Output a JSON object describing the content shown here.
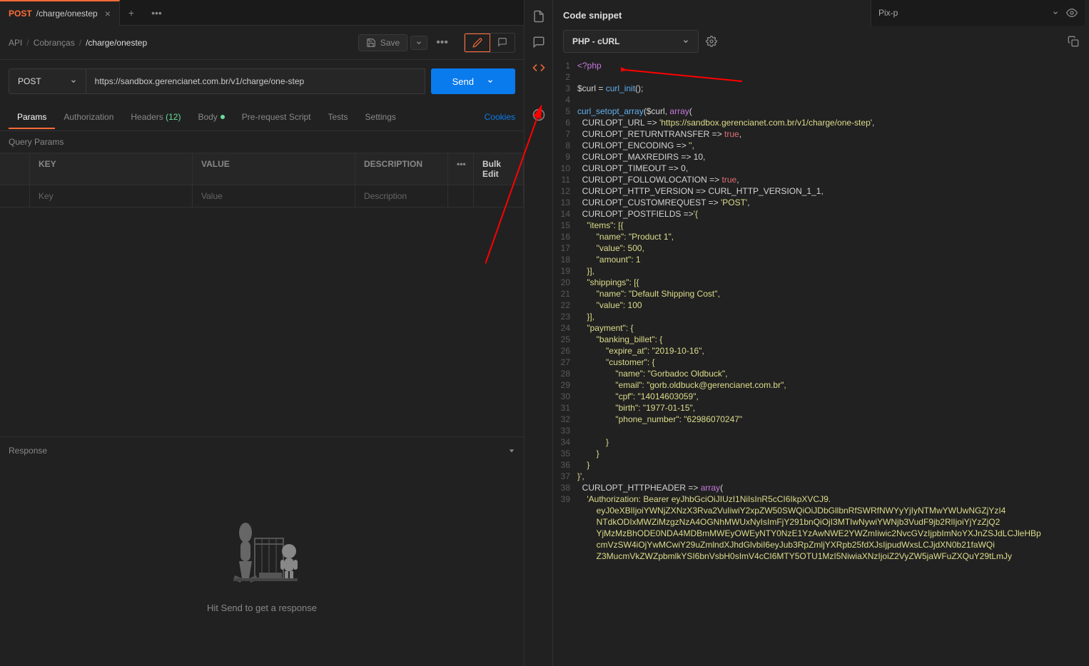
{
  "tabs": {
    "method": "POST",
    "title": "/charge/onestep"
  },
  "env": {
    "name": "Pix-p"
  },
  "breadcrumbs": {
    "a": "API",
    "b": "Cobranças",
    "c": "/charge/onestep"
  },
  "toolbar": {
    "save_label": "Save"
  },
  "request": {
    "method": "POST",
    "url": "https://sandbox.gerencianet.com.br/v1/charge/one-step",
    "send": "Send"
  },
  "reqtabs": {
    "params": "Params",
    "auth": "Authorization",
    "headers": "Headers",
    "headers_count": "(12)",
    "body": "Body",
    "prereq": "Pre-request Script",
    "tests": "Tests",
    "settings": "Settings",
    "cookies": "Cookies"
  },
  "qp": {
    "section": "Query Params",
    "key": "KEY",
    "value": "VALUE",
    "desc": "DESCRIPTION",
    "bulk": "Bulk Edit",
    "ph_key": "Key",
    "ph_value": "Value",
    "ph_desc": "Description"
  },
  "response": {
    "title": "Response",
    "empty": "Hit Send to get a response"
  },
  "snippet": {
    "title": "Code snippet",
    "language": "PHP - cURL",
    "lines": [
      {
        "n": 1,
        "tokens": [
          [
            "tag",
            "<?php"
          ]
        ]
      },
      {
        "n": 2,
        "tokens": [
          [
            "c",
            ""
          ]
        ]
      },
      {
        "n": 3,
        "tokens": [
          [
            "c",
            "$curl = "
          ],
          [
            "fn",
            "curl_init"
          ],
          [
            "c",
            "();"
          ]
        ]
      },
      {
        "n": 4,
        "tokens": [
          [
            "c",
            ""
          ]
        ]
      },
      {
        "n": 5,
        "tokens": [
          [
            "fn",
            "curl_setopt_array"
          ],
          [
            "c",
            "($curl, "
          ],
          [
            "kw",
            "array"
          ],
          [
            "c",
            "("
          ]
        ]
      },
      {
        "n": 6,
        "tokens": [
          [
            "c",
            "  CURLOPT_URL => "
          ],
          [
            "str",
            "'https://sandbox.gerencianet.com.br/v1/charge/one-step'"
          ],
          [
            "c",
            ","
          ]
        ]
      },
      {
        "n": 7,
        "tokens": [
          [
            "c",
            "  CURLOPT_RETURNTRANSFER => "
          ],
          [
            "lit",
            "true"
          ],
          [
            "c",
            ","
          ]
        ]
      },
      {
        "n": 8,
        "tokens": [
          [
            "c",
            "  CURLOPT_ENCODING => "
          ],
          [
            "str",
            "''"
          ],
          [
            "c",
            ","
          ]
        ]
      },
      {
        "n": 9,
        "tokens": [
          [
            "c",
            "  CURLOPT_MAXREDIRS => 10,"
          ]
        ]
      },
      {
        "n": 10,
        "tokens": [
          [
            "c",
            "  CURLOPT_TIMEOUT => 0,"
          ]
        ]
      },
      {
        "n": 11,
        "tokens": [
          [
            "c",
            "  CURLOPT_FOLLOWLOCATION => "
          ],
          [
            "lit",
            "true"
          ],
          [
            "c",
            ","
          ]
        ]
      },
      {
        "n": 12,
        "tokens": [
          [
            "c",
            "  CURLOPT_HTTP_VERSION => CURL_HTTP_VERSION_1_1,"
          ]
        ]
      },
      {
        "n": 13,
        "tokens": [
          [
            "c",
            "  CURLOPT_CUSTOMREQUEST => "
          ],
          [
            "str",
            "'POST'"
          ],
          [
            "c",
            ","
          ]
        ]
      },
      {
        "n": 14,
        "tokens": [
          [
            "c",
            "  CURLOPT_POSTFIELDS =>"
          ],
          [
            "str",
            "'{"
          ]
        ]
      },
      {
        "n": 15,
        "tokens": [
          [
            "str",
            "    \"items\": [{"
          ]
        ]
      },
      {
        "n": 16,
        "tokens": [
          [
            "str",
            "        \"name\": \"Product 1\","
          ]
        ]
      },
      {
        "n": 17,
        "tokens": [
          [
            "str",
            "        \"value\": 500,"
          ]
        ]
      },
      {
        "n": 18,
        "tokens": [
          [
            "str",
            "        \"amount\": 1"
          ]
        ]
      },
      {
        "n": 19,
        "tokens": [
          [
            "str",
            "    }],"
          ]
        ]
      },
      {
        "n": 20,
        "tokens": [
          [
            "str",
            "    \"shippings\": [{"
          ]
        ]
      },
      {
        "n": 21,
        "tokens": [
          [
            "str",
            "        \"name\": \"Default Shipping Cost\","
          ]
        ]
      },
      {
        "n": 22,
        "tokens": [
          [
            "str",
            "        \"value\": 100"
          ]
        ]
      },
      {
        "n": 23,
        "tokens": [
          [
            "str",
            "    }],"
          ]
        ]
      },
      {
        "n": 24,
        "tokens": [
          [
            "str",
            "    \"payment\": {"
          ]
        ]
      },
      {
        "n": 25,
        "tokens": [
          [
            "str",
            "        \"banking_billet\": {"
          ]
        ]
      },
      {
        "n": 26,
        "tokens": [
          [
            "str",
            "            \"expire_at\": \"2019-10-16\","
          ]
        ]
      },
      {
        "n": 27,
        "tokens": [
          [
            "str",
            "            \"customer\": {"
          ]
        ]
      },
      {
        "n": 28,
        "tokens": [
          [
            "str",
            "                \"name\": \"Gorbadoc Oldbuck\","
          ]
        ]
      },
      {
        "n": 29,
        "tokens": [
          [
            "str",
            "                \"email\": \"gorb.oldbuck@gerencianet.com.br\","
          ]
        ]
      },
      {
        "n": 30,
        "tokens": [
          [
            "str",
            "                \"cpf\": \"14014603059\","
          ]
        ]
      },
      {
        "n": 31,
        "tokens": [
          [
            "str",
            "                \"birth\": \"1977-01-15\","
          ]
        ]
      },
      {
        "n": 32,
        "tokens": [
          [
            "str",
            "                \"phone_number\": \"62986070247\""
          ]
        ]
      },
      {
        "n": 33,
        "tokens": [
          [
            "str",
            ""
          ]
        ]
      },
      {
        "n": 34,
        "tokens": [
          [
            "str",
            "            }"
          ]
        ]
      },
      {
        "n": 35,
        "tokens": [
          [
            "str",
            "        }"
          ]
        ]
      },
      {
        "n": 36,
        "tokens": [
          [
            "str",
            "    }"
          ]
        ]
      },
      {
        "n": 37,
        "tokens": [
          [
            "str",
            "}'"
          ],
          [
            "c",
            ","
          ]
        ]
      },
      {
        "n": 38,
        "tokens": [
          [
            "c",
            "  CURLOPT_HTTPHEADER => "
          ],
          [
            "kw",
            "array"
          ],
          [
            "c",
            "("
          ]
        ]
      },
      {
        "n": 39,
        "tokens": [
          [
            "c",
            "    "
          ],
          [
            "str",
            "'Authorization: Bearer eyJhbGciOiJIUzI1NiIsInR5cCI6IkpXVCJ9."
          ]
        ]
      },
      {
        "n": "",
        "tokens": [
          [
            "str",
            "        eyJ0eXBlIjoiYWNjZXNzX3Rva2VuIiwiY2xpZW50SWQiOiJDbGllbnRfSWRfNWYyYjIyNTMwYWUwNGZjYzI4"
          ]
        ]
      },
      {
        "n": "",
        "tokens": [
          [
            "str",
            "        NTdkODIxMWZiMzgzNzA4OGNhMWUxNyIsImFjY291bnQiOjI3MTIwNywiYWNjb3VudF9jb2RlIjoiYjYzZjQ2"
          ]
        ]
      },
      {
        "n": "",
        "tokens": [
          [
            "str",
            "        YjMzMzBhODE0NDA4MDBmMWEyOWEyNTY0NzE1YzAwNWE2YWZmIiwic2NvcGVzIjpbImNoYXJnZSJdLCJleHBp"
          ]
        ]
      },
      {
        "n": "",
        "tokens": [
          [
            "str",
            "        cmVzSW4iOjYwMCwiY29uZmlndXJhdGlvbiI6eyJub3RpZmljYXRpb25fdXJsIjpudWxsLCJjdXN0b21faWQi"
          ]
        ]
      },
      {
        "n": "",
        "tokens": [
          [
            "str",
            "        Z3MucmVkZWZpbmlkYSI6bnVsbH0sImV4cCI6MTY5OTU1MzI5NiwiaXNzIjoiZ2VyZW5jaWFuZXQuY29tLmJy"
          ]
        ]
      }
    ]
  }
}
